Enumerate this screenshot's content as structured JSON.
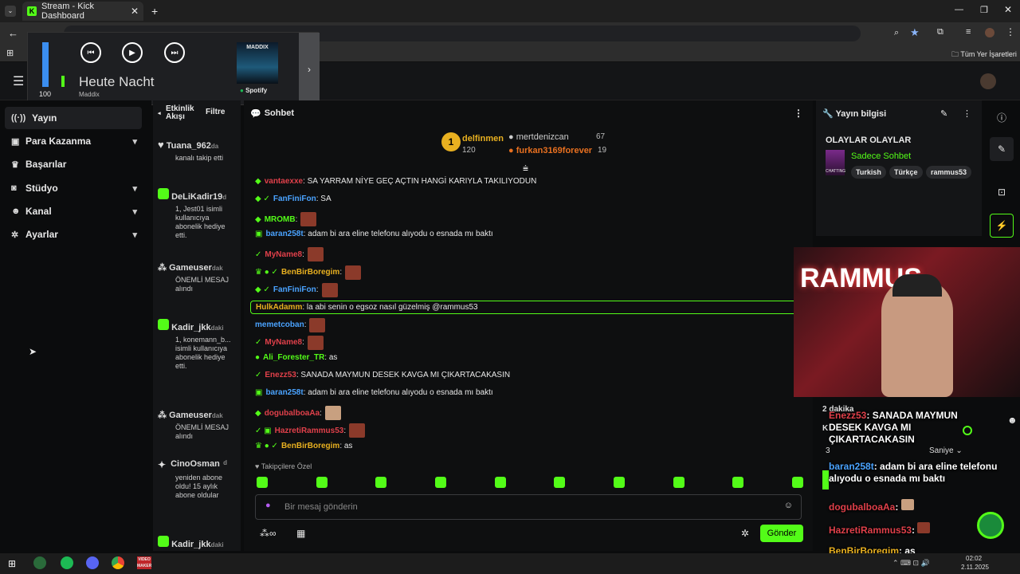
{
  "browser": {
    "tab_title": "Stream - Kick Dashboard",
    "bookmarks_label": "Tüm Yer İşaretleri"
  },
  "media": {
    "volume": "100",
    "track": "Heute Nacht",
    "artist": "Maddix",
    "cover_text": "MADDIX",
    "service": "Spotify"
  },
  "sidebar": {
    "items": [
      {
        "label": "Yayın",
        "icon": "broadcast-icon"
      },
      {
        "label": "Para Kazanma",
        "icon": "money-icon"
      },
      {
        "label": "Başarılar",
        "icon": "trophy-icon"
      },
      {
        "label": "Stüdyo",
        "icon": "studio-icon"
      },
      {
        "label": "Kanal",
        "icon": "users-icon"
      },
      {
        "label": "Ayarlar",
        "icon": "gear-icon"
      }
    ]
  },
  "activity": {
    "title": "Etkinlik Akışı",
    "filter": "Filtre",
    "items": [
      {
        "name": "Tuana_962",
        "time": "da",
        "desc": "kanalı takip etti"
      },
      {
        "name": "DeLiKadir19",
        "time": "d",
        "desc": "1, Jest01 isimli kullanıcıya abonelik hediye etti."
      },
      {
        "name": "Gameuser",
        "time": "dak",
        "desc": "ÖNEMLİ MESAJ alındı"
      },
      {
        "name": "Kadir_jkk",
        "time": "daki",
        "desc": "1, konemann_b... isimli kullanıcıya abonelik hediye etti."
      },
      {
        "name": "Gameuser",
        "time": "dak",
        "desc": "ÖNEMLİ MESAJ alındı"
      },
      {
        "name": "CinoOsman",
        "time": "d",
        "desc": "yeniden abone oldu! 15 aylık abone oldular"
      },
      {
        "name": "Kadir_jkk",
        "time": "daki",
        "desc": ""
      }
    ]
  },
  "chat": {
    "title": "Sohbet",
    "top": [
      {
        "name": "delfinmen",
        "value": "120",
        "rank": "1"
      },
      {
        "name": "mertdenizcan",
        "value": "67"
      },
      {
        "name": "furkan3169forever",
        "value": "19"
      }
    ],
    "messages": [
      {
        "user": "vantaexxe",
        "color": "#e0404a",
        "text": ": SA YARRAM NİYE GEÇ AÇTIN HANGİ KARIYLA TAKILIYODUN"
      },
      {
        "user": "FanFiniFon",
        "color": "#4aa3ff",
        "text": ": SA"
      },
      {
        "user": "MROMB",
        "color": "#53fc18",
        "text": ":"
      },
      {
        "user": "baran258t",
        "color": "#4aa3ff",
        "text": ": adam bi ara eline telefonu alıyodu o esnada mı baktı"
      },
      {
        "user": "MyName8",
        "color": "#e0404a",
        "text": ":"
      },
      {
        "user": "BenBirBoregim",
        "color": "#e8b020",
        "text": ":"
      },
      {
        "user": "FanFiniFon",
        "color": "#4aa3ff",
        "text": ":"
      },
      {
        "user": "HulkAdamm",
        "color": "#e8b020",
        "text": ": la abi senin o egsoz nasıl güzelmiş @rammus53"
      },
      {
        "user": "memetcoban",
        "color": "#4aa3ff",
        "text": ":"
      },
      {
        "user": "MyName8",
        "color": "#e0404a",
        "text": ":"
      },
      {
        "user": "Ali_Forester_TR",
        "color": "#53fc18",
        "text": ": as"
      },
      {
        "user": "Enezz53",
        "color": "#e0404a",
        "text": ": SANADA MAYMUN DESEK KAVGA MI ÇIKARTACAKASIN"
      },
      {
        "user": "baran258t",
        "color": "#4aa3ff",
        "text": ": adam bi ara eline telefonu alıyodu o esnada mı baktı"
      },
      {
        "user": "dogubalboaAa",
        "color": "#e0404a",
        "text": ":"
      },
      {
        "user": "HazretiRammus53",
        "color": "#e0404a",
        "text": ":"
      },
      {
        "user": "BenBirBoregim",
        "color": "#e8b020",
        "text": ": as"
      }
    ],
    "followers_only": "Takipçilere Özel",
    "placeholder": "Bir mesaj gönderin",
    "send": "Gönder"
  },
  "info": {
    "title": "Yayın bilgisi",
    "stream_title": "OLAYLAR OLAYLAR",
    "category": "Sadece Sohbet",
    "tags": [
      "Turkish",
      "Türkçe",
      "rammus53"
    ],
    "cover_text": "CHATTING"
  },
  "webcam": {
    "sign": "RAMMUS"
  },
  "overlay": {
    "behind1": "2 dakika",
    "behind2": "K",
    "behind3": "3",
    "select": "Saniye",
    "msgs": [
      {
        "user": "Enezz53",
        "text": ": SANADA MAYMUN DESEK KAVGA MI ÇIKARTACAKASIN",
        "color": "#e0404a"
      },
      {
        "user": "baran258t",
        "text": ": adam bi ara eline telefonu alıyodu o esnada mı baktı",
        "color": "#4aa3ff"
      },
      {
        "user": "dogubalboaAa",
        "text": ":",
        "color": "#e0404a"
      },
      {
        "user": "HazretiRammus53",
        "text": ":",
        "color": "#e0404a"
      },
      {
        "user": "BenBirBoregim",
        "text": ": as",
        "color": "#e8b020"
      }
    ]
  },
  "taskbar": {
    "time": "02:02",
    "date": "2.11.2025",
    "app_label": "VIDEO MAKER"
  }
}
